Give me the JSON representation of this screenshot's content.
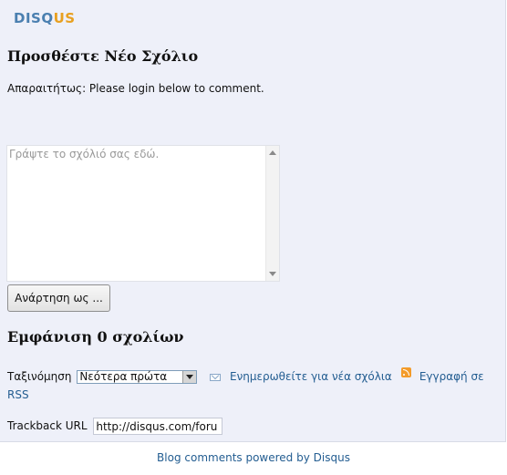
{
  "logo": {
    "part1": "DISQ",
    "part2": "US"
  },
  "add_comment": {
    "title": "Προσθέστε Νέο Σχόλιο",
    "required_text": "Απαραιτήτως: Please login below to comment.",
    "textarea_placeholder": "Γράψτε το σχόλιό σας εδώ.",
    "post_button": "Ανάρτηση ως ..."
  },
  "comments": {
    "title": "Εμφάνιση 0 σχολίων",
    "sort_label": "Ταξινόμηση",
    "sort_selected": "Νεότερα πρώτα",
    "subscribe_label": "Ενημερωθείτε για νέα σχόλια",
    "rss_label": "Εγγραφή σε RSS"
  },
  "trackback": {
    "label": "Trackback URL",
    "value": "http://disqus.com/foru"
  },
  "footer": {
    "text": "Blog comments powered by Disqus"
  },
  "colors": {
    "panel_bg": "#eef0f9",
    "link": "#235d91",
    "logo_blue": "#4a7fb0",
    "logo_orange": "#e8a020"
  },
  "icons": [
    "mail-icon",
    "rss-icon",
    "scroll-up-icon",
    "scroll-down-icon",
    "dropdown-arrow-icon"
  ]
}
